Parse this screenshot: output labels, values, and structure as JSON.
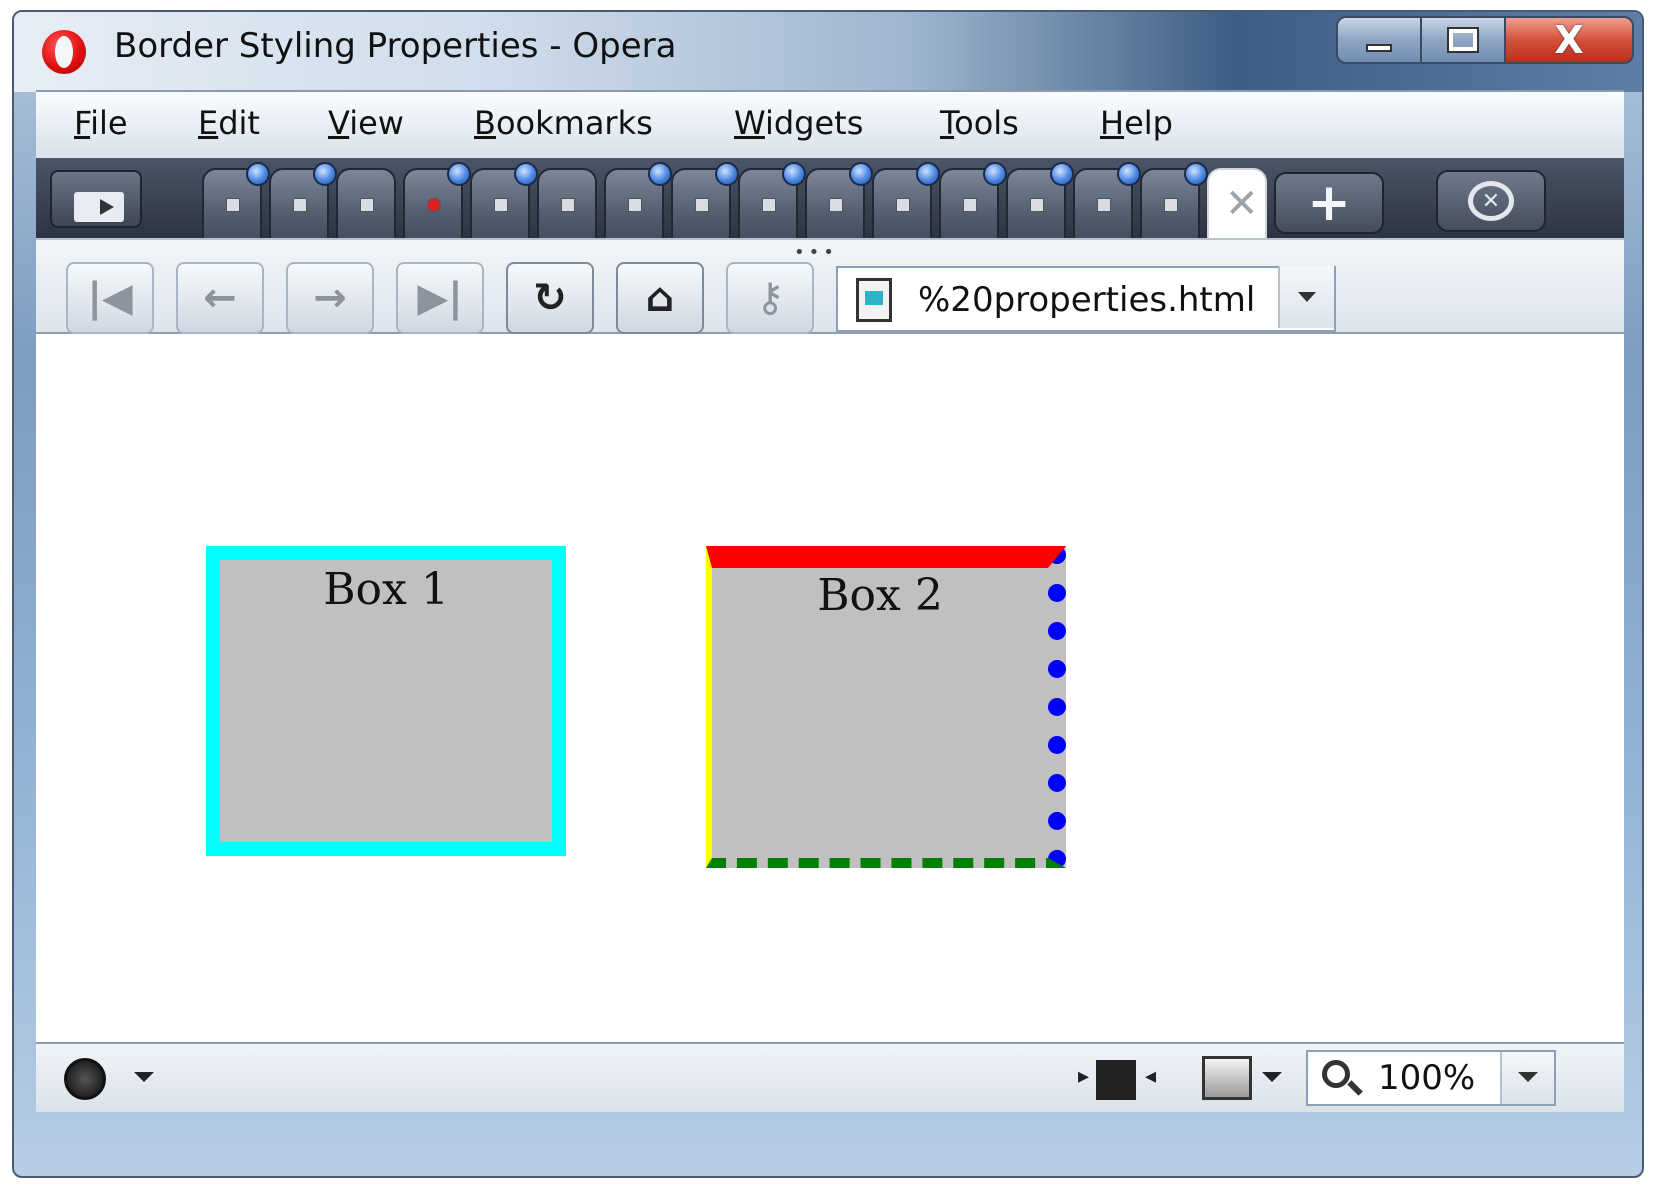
{
  "window": {
    "title": "Border Styling Properties - Opera",
    "controls": {
      "minimize": "minimize",
      "maximize": "maximize",
      "close": "X"
    }
  },
  "menu": {
    "items": [
      {
        "label": "File"
      },
      {
        "label": "Edit"
      },
      {
        "label": "View"
      },
      {
        "label": "Bookmarks"
      },
      {
        "label": "Widgets"
      },
      {
        "label": "Tools"
      },
      {
        "label": "Help"
      }
    ]
  },
  "tabs": {
    "count": 16,
    "active_close_glyph": "✕",
    "new_tab_glyph": "+"
  },
  "toolbar": {
    "rewind": "|◀",
    "back": "←",
    "forward": "→",
    "fast_forward": "▶|",
    "reload": "↻",
    "home": "⌂",
    "wand": "⚷",
    "address": "%20properties.html"
  },
  "page": {
    "box1_label": "Box 1",
    "box2_label": "Box 2",
    "colors": {
      "box1_border": "#00ffff",
      "box_bg": "#c0c0c0",
      "box2_top": "#ff0000",
      "box2_right": "#0000ff",
      "box2_bottom": "#008000",
      "box2_left": "#ffff00"
    }
  },
  "status": {
    "zoom": "100%"
  }
}
